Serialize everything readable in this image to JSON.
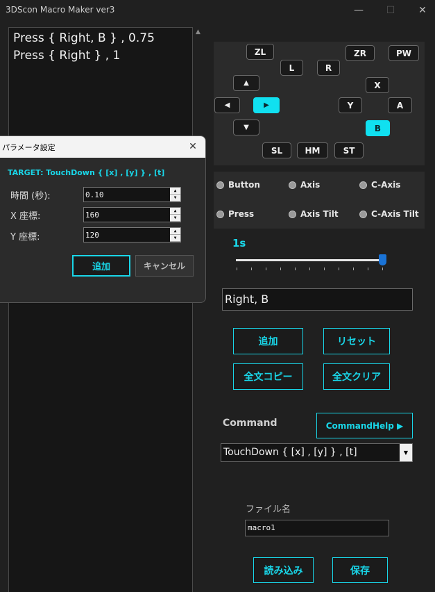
{
  "window": {
    "title": "3DScon Macro Maker ver3",
    "minimize": "—",
    "maximize": "☐",
    "close": "✕"
  },
  "macro_lines": [
    "Press { Right, B } , 0.75",
    "Press { Right } , 1"
  ],
  "pad": {
    "zl": "ZL",
    "zr": "ZR",
    "pw": "PW",
    "l": "L",
    "r": "R",
    "up": "▲",
    "x": "X",
    "left": "◀",
    "right": "▶",
    "y": "Y",
    "a": "A",
    "down": "▼",
    "b": "B",
    "sl": "SL",
    "hm": "HM",
    "st": "ST"
  },
  "modes": {
    "button": "Button",
    "axis": "Axis",
    "c_axis": "C-Axis",
    "press": "Press",
    "axis_tilt": "Axis Tilt",
    "c_axis_tilt": "C-Axis Tilt"
  },
  "duration": {
    "label": "1s",
    "level": 1.0
  },
  "selected_buttons": "Right, B",
  "actions": {
    "add": "追加",
    "reset": "リセット",
    "copy_all": "全文コピー",
    "clear_all": "全文クリア"
  },
  "command": {
    "label": "Command",
    "help": "CommandHelp ▶",
    "selected": "TouchDown { [x] , [y] } , [t]"
  },
  "file": {
    "label": "ファイル名",
    "value": "macro1",
    "load": "読み込み",
    "save": "保存"
  },
  "dialog": {
    "title": "パラメータ設定",
    "target": "TARGET: TouchDown { [x] , [y] } , [t]",
    "time_label": "時間 (秒):",
    "time_value": "0.10",
    "x_label": "X 座標:",
    "x_value": "160",
    "y_label": "Y 座標:",
    "y_value": "120",
    "add": "追加",
    "cancel": "キャンセル",
    "close": "✕"
  },
  "colors": {
    "accent": "#19d6e8",
    "active_button": "#10e0f0",
    "slider_thumb": "#1a73d6"
  }
}
